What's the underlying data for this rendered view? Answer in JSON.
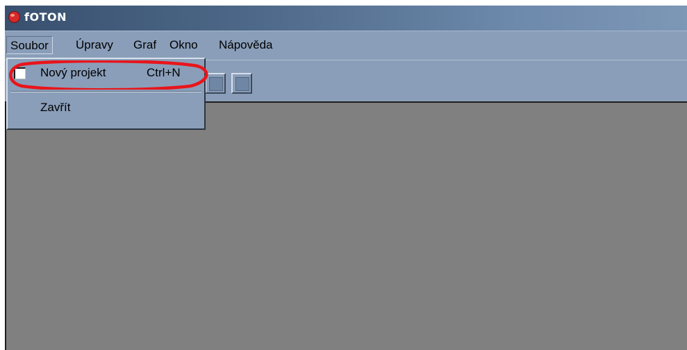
{
  "window": {
    "title": "fOTON",
    "icon": "red-pepper-app-icon"
  },
  "menubar": {
    "items": [
      {
        "label": "Soubor",
        "open": true
      },
      {
        "label": "Úpravy"
      },
      {
        "label": "Graf"
      },
      {
        "label": "Okno"
      },
      {
        "label": "Nápověda"
      }
    ]
  },
  "dropdown": {
    "items": [
      {
        "label": "Nový projekt",
        "shortcut": "Ctrl+N",
        "icon": "new-document-icon"
      },
      {
        "label": "Zavřít"
      }
    ]
  },
  "toolbar": {
    "buttons": [
      "toolbar-button-1",
      "toolbar-button-2",
      "toolbar-button-3"
    ]
  },
  "colors": {
    "titlebar_start": "#39506f",
    "titlebar_end": "#7d97b6",
    "menu_bg": "#8a9eb9",
    "client_bg": "#808080",
    "highlight_ring": "#e8151b"
  }
}
